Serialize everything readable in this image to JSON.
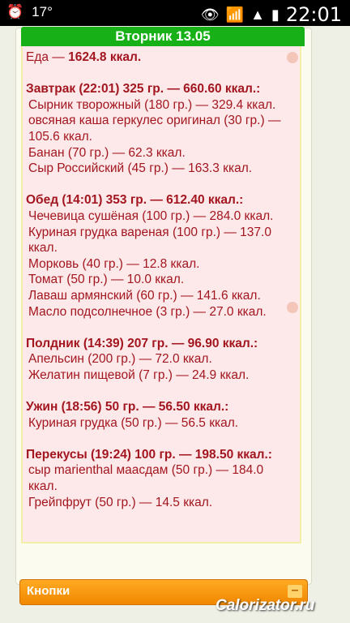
{
  "status": {
    "temp": "17°",
    "time": "22:01"
  },
  "header": {
    "day_title": "Вторник 13.05"
  },
  "diary": {
    "total": {
      "label": "Еда — ",
      "value": "1624.8 ккал."
    },
    "meals": [
      {
        "title": "Завтрак (22:01) 325 гр. — 660.60 ккал.:",
        "items": [
          "Сырник творожный (180 гр.) — 329.4 ккал.",
          "овсяная каша геркулес оригинал (30 гр.) — 105.6 ккал.",
          "Банан (70 гр.) — 62.3 ккал.",
          "Сыр Российский (45 гр.) — 163.3 ккал."
        ]
      },
      {
        "title": "Обед (14:01) 353 гр. — 612.40 ккал.:",
        "items": [
          "Чечевица сушёная (100 гр.) — 284.0 ккал.",
          "Куриная грудка вареная (100 гр.) — 137.0 ккал.",
          "Морковь (40 гр.) — 12.8 ккал.",
          "Томат (50 гр.) — 10.0 ккал.",
          "Лаваш армянский (60 гр.) — 141.6 ккал.",
          "Масло подсолнечное (3 гр.) — 27.0 ккал."
        ]
      },
      {
        "title": "Полдник (14:39) 207 гр. — 96.90 ккал.:",
        "items": [
          "Апельсин (200 гр.) — 72.0 ккал.",
          "Желатин пищевой (7 гр.) — 24.9 ккал."
        ]
      },
      {
        "title": "Ужин (18:56) 50 гр. — 56.50 ккал.:",
        "items": [
          "Куриная грудка (50 гр.) — 56.5 ккал."
        ]
      },
      {
        "title": "Перекусы (19:24) 100 гр. — 198.50 ккал.:",
        "items": [
          "сыр marienthal маасдам (50 гр.) — 184.0 ккал.",
          "Грейпфрут (50 гр.) — 14.5 ккал."
        ]
      }
    ]
  },
  "buttons_panel": {
    "label": "Кнопки",
    "toggle": "–"
  },
  "watermark": "Calorizator.ru"
}
